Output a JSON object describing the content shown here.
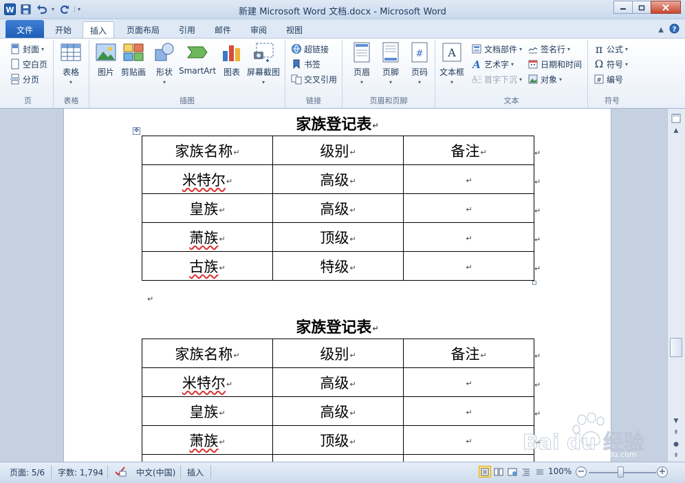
{
  "window": {
    "title": "新建 Microsoft Word 文档.docx - Microsoft Word",
    "app_icon": "W"
  },
  "tabs": {
    "file": "文件",
    "items": [
      "开始",
      "插入",
      "页面布局",
      "引用",
      "邮件",
      "审阅",
      "视图"
    ],
    "active": "插入"
  },
  "ribbon": {
    "pages": {
      "label": "页",
      "cover": "封面",
      "blank": "空白页",
      "break": "分页"
    },
    "tables": {
      "label": "表格",
      "table": "表格"
    },
    "illustrations": {
      "label": "插图",
      "picture": "图片",
      "clipart": "剪贴画",
      "shapes": "形状",
      "smartart": "SmartArt",
      "chart": "图表",
      "screenshot": "屏幕截图"
    },
    "links": {
      "label": "链接",
      "hyperlink": "超链接",
      "bookmark": "书签",
      "crossref": "交叉引用"
    },
    "header_footer": {
      "label": "页眉和页脚",
      "header": "页眉",
      "footer": "页脚",
      "pagenum": "页码"
    },
    "text": {
      "label": "文本",
      "textbox": "文本框",
      "quickparts": "文档部件",
      "wordart": "艺术字",
      "dropcap": "首字下沉",
      "signature": "签名行",
      "datetime": "日期和时间",
      "object": "对象"
    },
    "symbols": {
      "label": "符号",
      "equation": "公式",
      "symbol": "符号",
      "number": "编号"
    }
  },
  "document": {
    "tables": [
      {
        "title": "家族登记表",
        "header": [
          "家族名称",
          "级别",
          "备注"
        ],
        "rows": [
          [
            "米特尔",
            "高级",
            ""
          ],
          [
            "皇族",
            "高级",
            ""
          ],
          [
            "萧族",
            "顶级",
            ""
          ],
          [
            "古族",
            "特级",
            ""
          ]
        ]
      },
      {
        "title": "家族登记表",
        "header": [
          "家族名称",
          "级别",
          "备注"
        ],
        "rows": [
          [
            "米特尔",
            "高级",
            ""
          ],
          [
            "皇族",
            "高级",
            ""
          ],
          [
            "萧族",
            "顶级",
            ""
          ]
        ]
      }
    ]
  },
  "statusbar": {
    "page": "页面: 5/6",
    "words": "字数: 1,794",
    "language": "中文(中国)",
    "mode": "插入",
    "zoom": "100%",
    "zoom_value": 100
  },
  "watermark": {
    "brand": "Bai du 经验",
    "url": "jingyan.baidu.com"
  },
  "colors": {
    "file_tab": "#2a6ac4",
    "ribbon_bg": "#ffffff",
    "doc_bg": "#c5d1e0",
    "page": "#ffffff"
  }
}
